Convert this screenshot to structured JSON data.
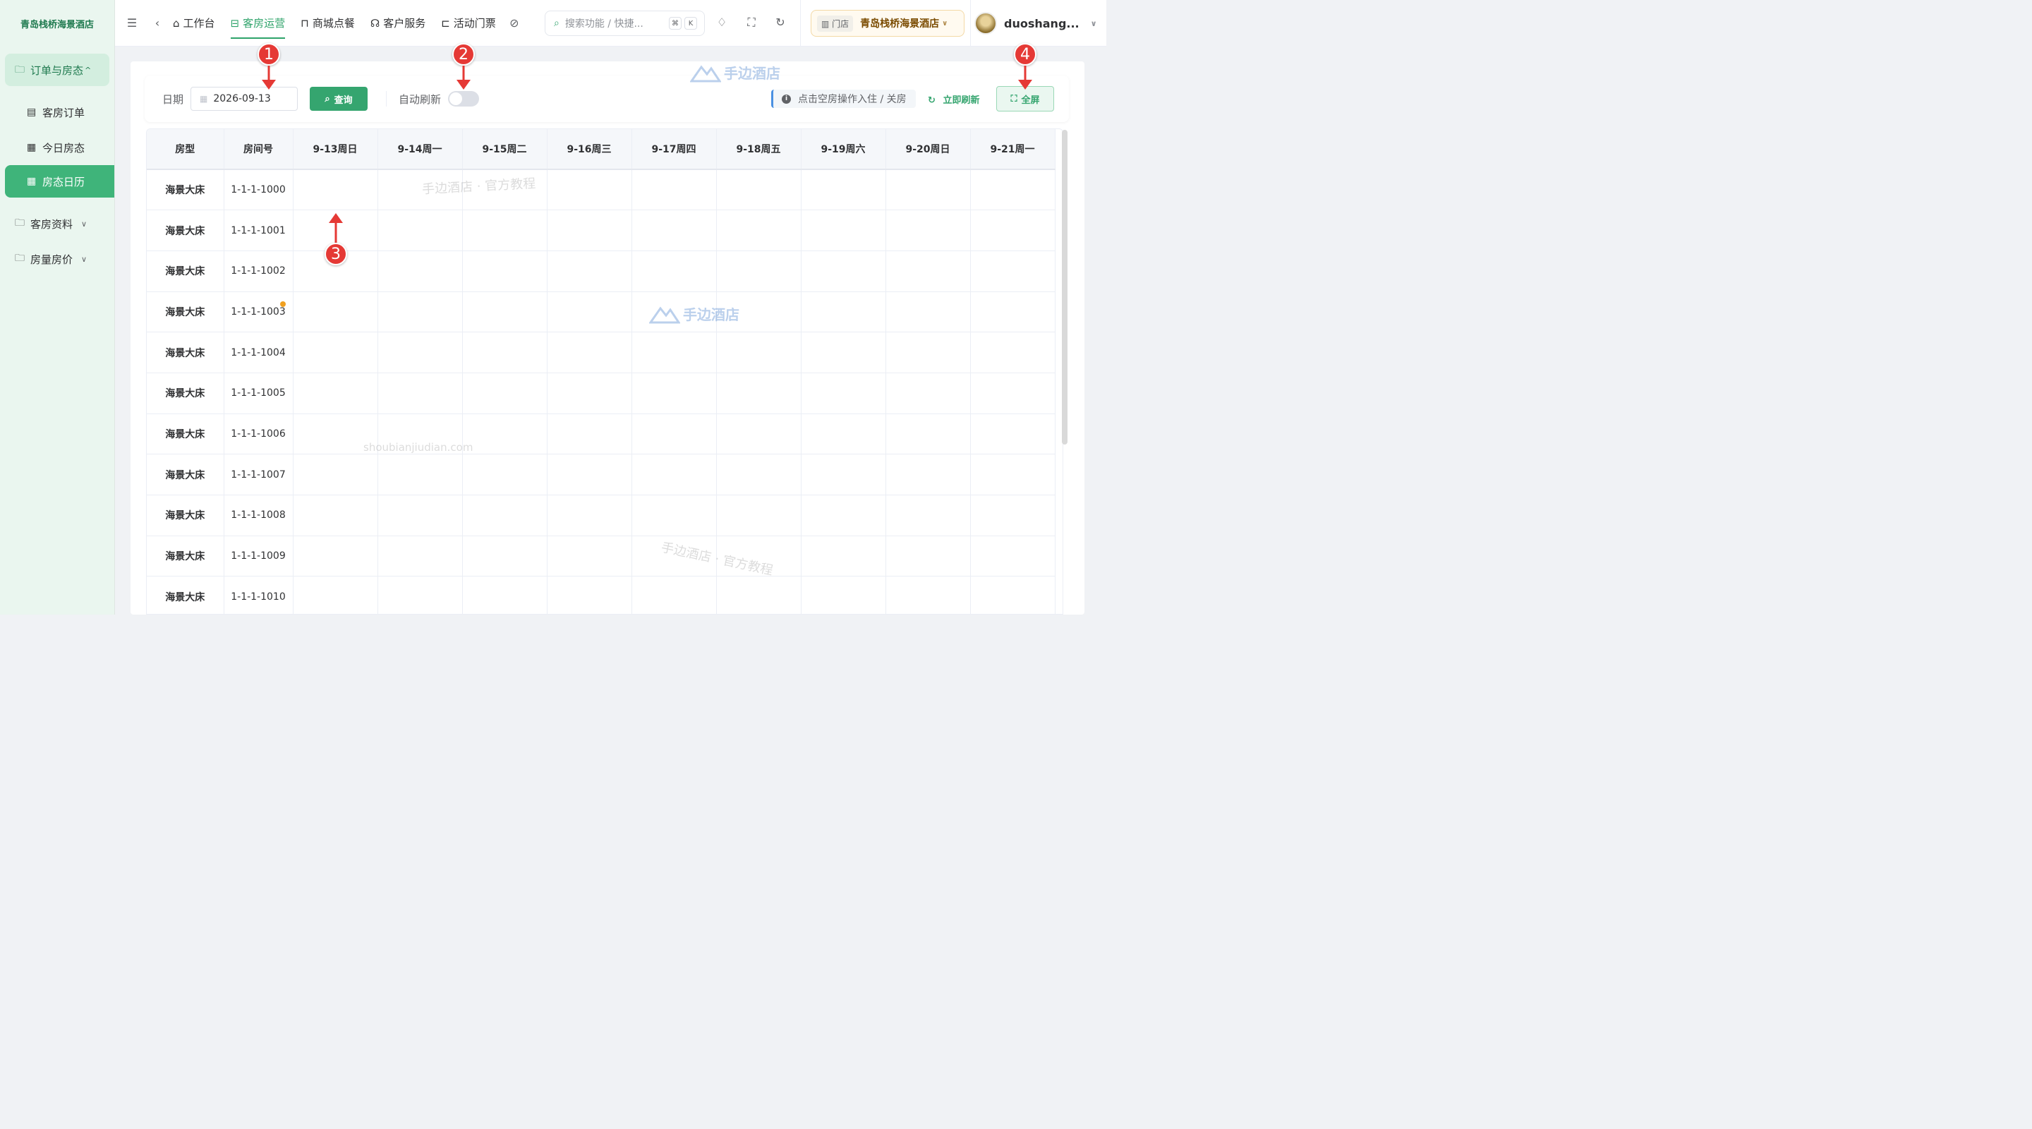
{
  "sidebar": {
    "brand": "青岛栈桥海景酒店",
    "group_label": "订单与房态",
    "sub_items": [
      {
        "icon": "order-icon",
        "label": "客房订单"
      },
      {
        "icon": "calendar-check-icon",
        "label": "今日房态"
      },
      {
        "icon": "calendar-icon",
        "label": "房态日历"
      }
    ],
    "menu_rows": [
      {
        "label": "客房资料"
      },
      {
        "label": "房量房价"
      }
    ]
  },
  "topbar": {
    "tabs": [
      {
        "icon": "home-icon",
        "label": "工作台"
      },
      {
        "icon": "bed-icon",
        "label": "客房运营"
      },
      {
        "icon": "bag-icon",
        "label": "商城点餐"
      },
      {
        "icon": "headset-icon",
        "label": "客户服务"
      },
      {
        "icon": "ticket-icon",
        "label": "活动门票"
      }
    ],
    "search_placeholder": "搜索功能 / 快捷...",
    "kbd1": "⌘",
    "kbd2": "K",
    "store_tag": "门店",
    "store_name": "青岛栈桥海景酒店",
    "user_name": "duoshang..."
  },
  "toolbar": {
    "date_label": "日期",
    "date_value": "2026-09-13",
    "query_label": "查询",
    "auto_refresh_label": "自动刷新",
    "auto_refresh_on": false,
    "hint": "点击空房操作入住 / 关房",
    "refresh_label": "立即刷新",
    "fullscreen_label": "全屏"
  },
  "grid": {
    "col_room_type": "房型",
    "col_room_no": "房间号",
    "dates": [
      "9-13周日",
      "9-14周一",
      "9-15周二",
      "9-16周三",
      "9-17周四",
      "9-18周五",
      "9-19周六",
      "9-20周日",
      "9-21周一"
    ],
    "rows": [
      {
        "type": "海景大床",
        "no": "1-1-1-1000"
      },
      {
        "type": "海景大床",
        "no": "1-1-1-1001"
      },
      {
        "type": "海景大床",
        "no": "1-1-1-1002"
      },
      {
        "type": "海景大床",
        "no": "1-1-1-1003"
      },
      {
        "type": "海景大床",
        "no": "1-1-1-1004"
      },
      {
        "type": "海景大床",
        "no": "1-1-1-1005"
      },
      {
        "type": "海景大床",
        "no": "1-1-1-1006"
      },
      {
        "type": "海景大床",
        "no": "1-1-1-1007"
      },
      {
        "type": "海景大床",
        "no": "1-1-1-1008"
      },
      {
        "type": "海景大床",
        "no": "1-1-1-1009"
      },
      {
        "type": "海景大床",
        "no": "1-1-1-1010"
      }
    ]
  },
  "watermarks": {
    "brand": "手边酒店",
    "tutorial": "手边酒店 · 官方教程",
    "domain": "shoubianjiudian.com"
  },
  "annotations": [
    "1",
    "2",
    "3",
    "4"
  ],
  "colors": {
    "accent": "#35a56f",
    "annotation": "#e53935"
  }
}
